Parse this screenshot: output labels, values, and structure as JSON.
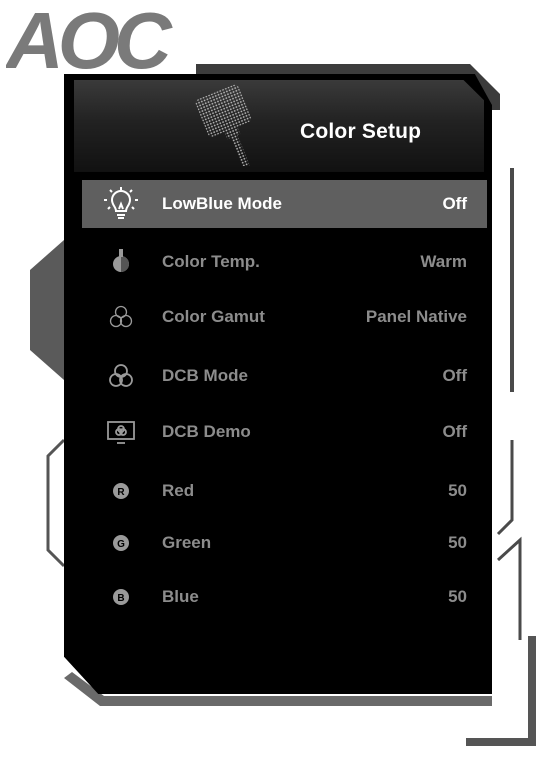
{
  "brand": {
    "logo_text": "AOC"
  },
  "header": {
    "title": "Color Setup",
    "icon": "color-brush-icon"
  },
  "menu": [
    {
      "label": "LowBlue Mode",
      "value": "Off",
      "icon": "lightbulb-icon",
      "selected": true
    },
    {
      "label": "Color Temp.",
      "value": "Warm",
      "icon": "thermometer-icon",
      "selected": false
    },
    {
      "label": "Color Gamut",
      "value": "Panel Native",
      "icon": "color-gamut-icon",
      "selected": false
    },
    {
      "label": "DCB Mode",
      "value": "Off",
      "icon": "dcb-mode-icon",
      "selected": false
    },
    {
      "label": "DCB Demo",
      "value": "Off",
      "icon": "dcb-demo-icon",
      "selected": false
    },
    {
      "label": "Red",
      "value": "50",
      "icon": "red-channel-icon",
      "selected": false
    },
    {
      "label": "Green",
      "value": "50",
      "icon": "green-channel-icon",
      "selected": false
    },
    {
      "label": "Blue",
      "value": "50",
      "icon": "blue-channel-icon",
      "selected": false
    }
  ],
  "colors": {
    "selected_row": "#5f5f5f",
    "panel": "#000000",
    "inactive_text": "#8c8c8c",
    "logo": "#7a7a7a"
  }
}
